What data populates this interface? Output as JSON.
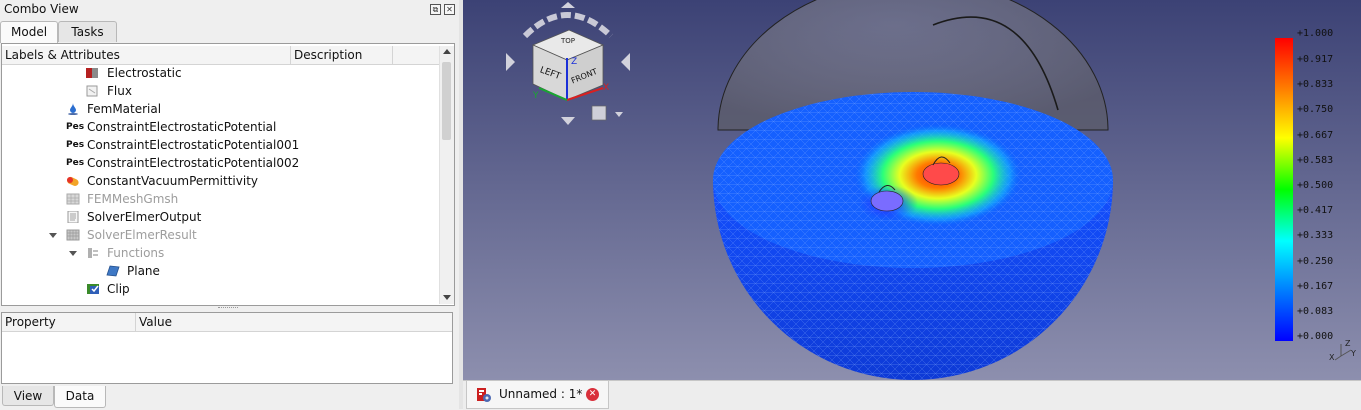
{
  "combo_view": {
    "title": "Combo View",
    "tabs": [
      {
        "label": "Model",
        "active": true
      },
      {
        "label": "Tasks",
        "active": false
      }
    ]
  },
  "tree": {
    "columns": [
      "Labels & Attributes",
      "Description"
    ],
    "items": [
      {
        "label": "Electrostatic",
        "icon": "electrostatic-icon",
        "dimmed": false
      },
      {
        "label": "Flux",
        "icon": "flux-icon",
        "dimmed": false
      },
      {
        "label": "FemMaterial",
        "icon": "material-drop-icon",
        "dimmed": false
      },
      {
        "label": "ConstraintElectrostaticPotential",
        "icon": "potential-constraint-icon",
        "icon_text": "Pes",
        "dimmed": false
      },
      {
        "label": "ConstraintElectrostaticPotential001",
        "icon": "potential-constraint-icon",
        "icon_text": "Pes",
        "dimmed": false
      },
      {
        "label": "ConstraintElectrostaticPotential002",
        "icon": "potential-constraint-icon",
        "icon_text": "Pes",
        "dimmed": false
      },
      {
        "label": "ConstantVacuumPermittivity",
        "icon": "permittivity-icon",
        "dimmed": false
      },
      {
        "label": "FEMMeshGmsh",
        "icon": "mesh-icon",
        "dimmed": true
      },
      {
        "label": "SolverElmerOutput",
        "icon": "text-document-icon",
        "dimmed": false
      },
      {
        "label": "SolverElmerResult",
        "icon": "result-grid-icon",
        "dimmed": true,
        "expanded": true
      },
      {
        "label": "Functions",
        "icon": "functions-icon",
        "dimmed": true,
        "expanded": true
      },
      {
        "label": "Plane",
        "icon": "plane-icon",
        "dimmed": false
      },
      {
        "label": "Clip",
        "icon": "clip-icon",
        "dimmed": false
      }
    ]
  },
  "property_view": {
    "columns": [
      "Property",
      "Value"
    ]
  },
  "bottom_tabs": [
    {
      "label": "View",
      "active": false
    },
    {
      "label": "Data",
      "active": true
    }
  ],
  "viewer": {
    "navcube": {
      "faces": {
        "top": "TOP",
        "left": "LEFT",
        "front": "FRONT"
      },
      "axes": {
        "x": "X",
        "y": "Y",
        "z": "Z"
      }
    },
    "legend": {
      "labels": [
        "+1.000",
        "+0.917",
        "+0.833",
        "+0.750",
        "+0.667",
        "+0.583",
        "+0.500",
        "+0.417",
        "+0.333",
        "+0.250",
        "+0.167",
        "+0.083",
        "+0.000"
      ],
      "colors_top_to_bottom": [
        "#ff0000",
        "#ff8000",
        "#ffff00",
        "#00ff00",
        "#00ffff",
        "#0080ff",
        "#0000ff"
      ]
    },
    "corner_axis": {
      "z": "Z",
      "y": "Y",
      "x": "X"
    }
  },
  "document_tab": {
    "label": "Unnamed : 1*",
    "icon": "freecad-document-icon",
    "close_icon": "close-icon"
  }
}
